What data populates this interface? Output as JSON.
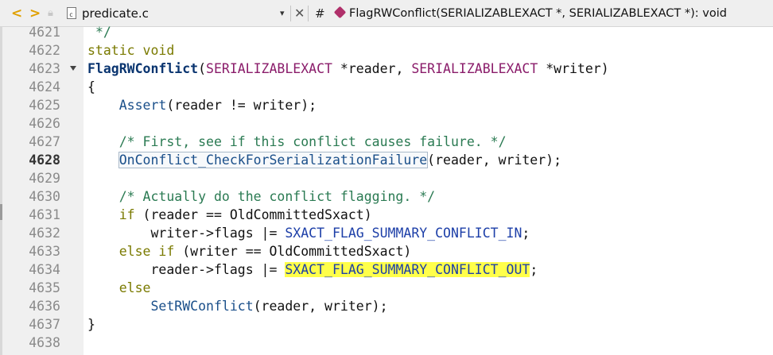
{
  "toolbar": {
    "back_label": "<",
    "forward_label": ">",
    "file_name": "predicate.c",
    "file_icon_text": "c",
    "dropdown_icon": "▾",
    "close_icon": "✕",
    "hash": "#",
    "function_signature": "FlagRWConflict(SERIALIZABLEXACT *, SERIALIZABLEXACT *): void"
  },
  "editor": {
    "current_line": "4628",
    "line_numbers": [
      "4621",
      "4622",
      "4623",
      "4624",
      "4625",
      "4626",
      "4627",
      "4628",
      "4629",
      "4630",
      "4631",
      "4632",
      "4633",
      "4634",
      "4635",
      "4636",
      "4637",
      "4638"
    ],
    "tokens": {
      "close_comment": "*/",
      "static_void": "static void",
      "fn_name": "FlagRWConflict",
      "paren_open": "(",
      "type1": "SERIALIZABLEXACT",
      "param1": " *reader, ",
      "type2": "SERIALIZABLEXACT",
      "param2": " *writer)",
      "brace_open": "{",
      "assert": "Assert",
      "assert_args": "(reader != writer);",
      "comment1": "/* First, see if this conflict causes failure. */",
      "oncheck": "OnConflict_CheckForSerializationFailure",
      "oncheck_args": "(reader, writer);",
      "comment2": "/* Actually do the conflict flagging. */",
      "if_kw": "if",
      "if_cond": " (reader == OldCommittedSxact)",
      "assign1_lhs": "writer->flags |= ",
      "macro_in": "SXACT_FLAG_SUMMARY_CONFLICT_IN",
      "semi": ";",
      "else_if_kw": "else if",
      "else_if_cond": " (writer == OldCommittedSxact)",
      "assign2_lhs": "reader->flags |= ",
      "macro_out": "SXACT_FLAG_SUMMARY_CONFLICT_OUT",
      "else_kw": "else",
      "setrw": "SetRWConflict",
      "setrw_args": "(reader, writer);",
      "brace_close": "}"
    }
  }
}
